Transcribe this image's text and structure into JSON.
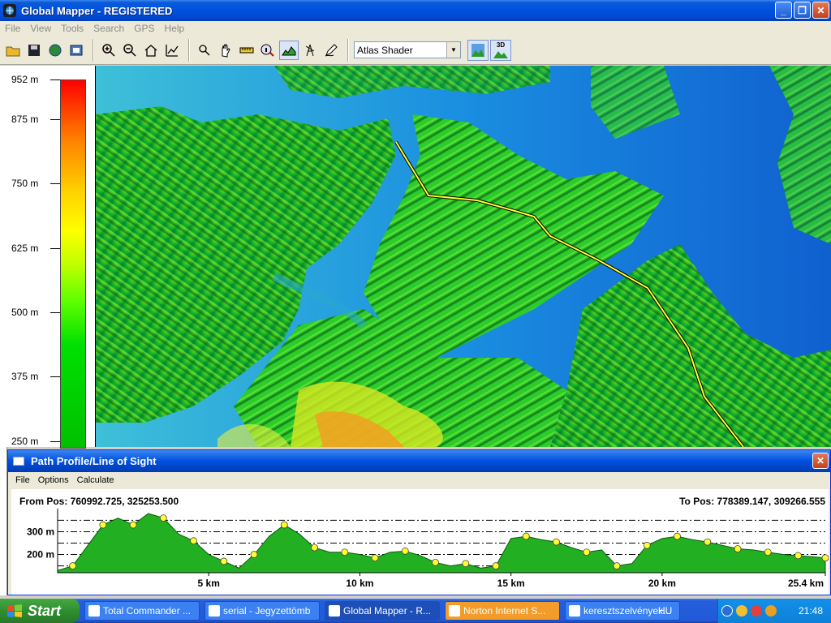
{
  "window": {
    "title": "Global Mapper - REGISTERED",
    "minimize": "_",
    "maximize": "❐",
    "close": "✕"
  },
  "menu": [
    "File",
    "View",
    "Tools",
    "Search",
    "GPS",
    "Help"
  ],
  "toolbar": {
    "shader_value": "Atlas Shader",
    "shader_dropdown": "▼",
    "btn_3d_label": "3D"
  },
  "legend": {
    "labels": [
      "952 m",
      "875 m",
      "750 m",
      "625 m",
      "500 m",
      "375 m",
      "250 m"
    ],
    "colors": {
      "max": "#ff0000",
      "mid": "#ffff00",
      "low": "#00c000"
    }
  },
  "profile": {
    "title": "Path Profile/Line of Sight",
    "close": "✕",
    "menu": [
      "File",
      "Options",
      "Calculate"
    ],
    "from_pos": "From Pos: 760992.725, 325253.500",
    "to_pos": "To Pos: 778389.147, 309266.555",
    "y_labels": [
      "300 m",
      "200 m"
    ],
    "x_labels": [
      "5 km",
      "10 km",
      "15 km",
      "20 km",
      "25.4 km"
    ],
    "fill_color": "#22b022"
  },
  "chart_data": {
    "type": "area",
    "xlabel": "",
    "ylabel": "",
    "x_unit": "km",
    "y_unit": "m",
    "x": [
      0,
      0.5,
      1,
      1.5,
      2,
      2.5,
      3,
      3.5,
      4,
      4.5,
      5,
      5.5,
      6,
      6.5,
      7,
      7.5,
      8,
      8.5,
      9,
      9.5,
      10,
      10.5,
      11,
      11.5,
      12,
      12.5,
      13,
      13.5,
      14,
      14.5,
      15,
      15.5,
      16,
      16.5,
      17,
      17.5,
      18,
      18.5,
      19,
      19.5,
      20,
      20.5,
      21,
      21.5,
      22,
      22.5,
      23,
      23.5,
      24,
      24.5,
      25,
      25.4
    ],
    "y": [
      130,
      150,
      240,
      330,
      360,
      330,
      380,
      360,
      290,
      260,
      200,
      170,
      140,
      200,
      280,
      330,
      290,
      230,
      210,
      210,
      200,
      185,
      210,
      215,
      195,
      165,
      150,
      160,
      140,
      150,
      270,
      280,
      265,
      255,
      230,
      210,
      220,
      150,
      160,
      240,
      270,
      280,
      265,
      255,
      240,
      225,
      220,
      210,
      200,
      195,
      190,
      185
    ],
    "ylim": [
      120,
      380
    ],
    "xlim": [
      0,
      25.4
    ],
    "x_ticks": [
      5,
      10,
      15,
      20,
      25.4
    ],
    "y_ticks": [
      200,
      300
    ]
  },
  "taskbar": {
    "start": "Start",
    "tasks": [
      "Total Commander ...",
      "serial - Jegyzettömb",
      "Global Mapper - R...",
      "Norton Internet S...",
      "keresztszelvények..."
    ],
    "lang": "HU",
    "clock": "21:48"
  }
}
